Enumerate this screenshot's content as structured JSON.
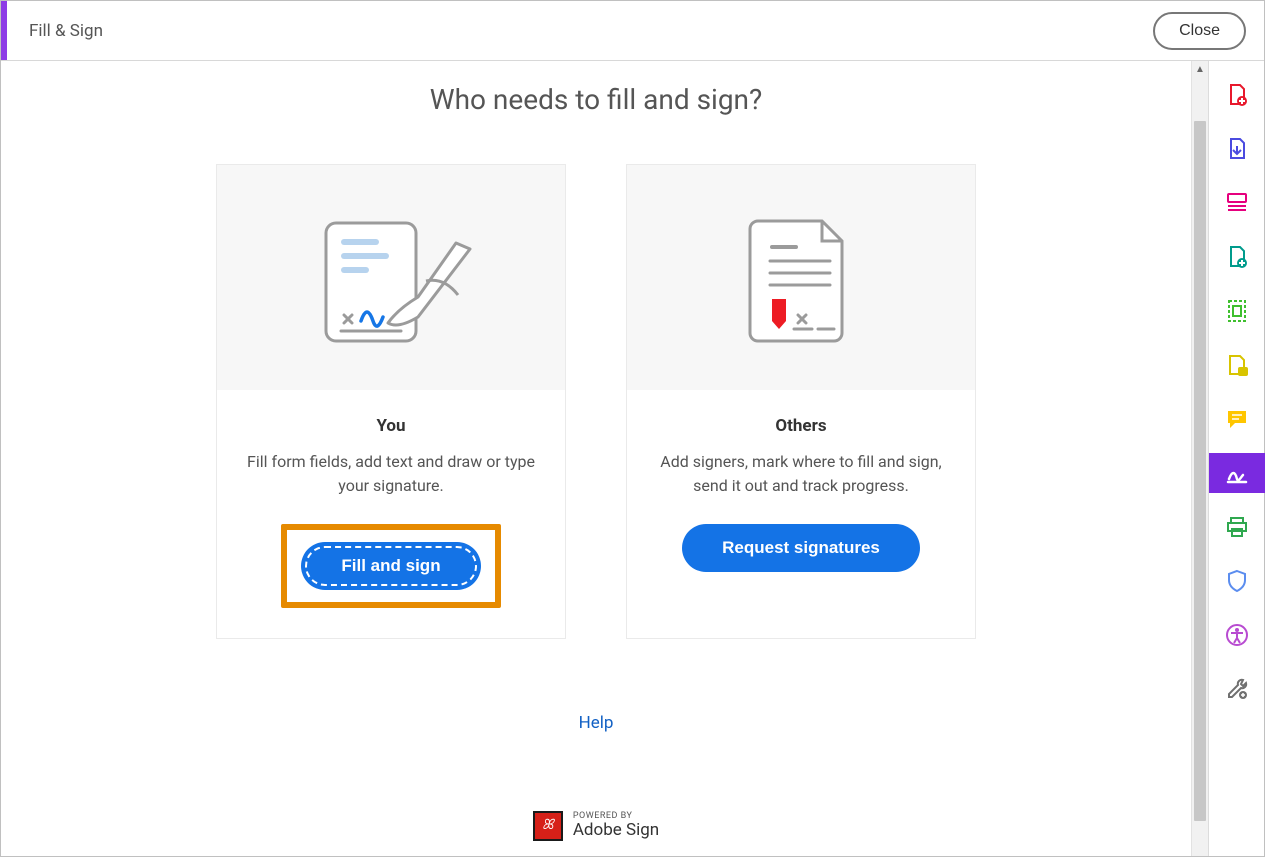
{
  "header": {
    "title": "Fill & Sign",
    "close_label": "Close"
  },
  "main": {
    "heading": "Who needs to fill and sign?",
    "cards": {
      "you": {
        "title": "You",
        "desc": "Fill form fields, add text and draw or type your signature.",
        "button": "Fill and sign"
      },
      "others": {
        "title": "Others",
        "desc": "Add signers, mark where to fill and sign, send it out and track progress.",
        "button": "Request signatures"
      }
    },
    "help_label": "Help",
    "powered_small": "POWERED BY",
    "powered_big": "Adobe Sign"
  },
  "rail": {
    "items": [
      {
        "name": "create-pdf-icon",
        "color": "#e8192c"
      },
      {
        "name": "export-pdf-icon",
        "color": "#4b4be0"
      },
      {
        "name": "organize-pages-icon",
        "color": "#e6007e"
      },
      {
        "name": "combine-files-icon",
        "color": "#009b8c"
      },
      {
        "name": "edit-pdf-icon",
        "color": "#3fbf2f"
      },
      {
        "name": "compare-icon",
        "color": "#d8c400"
      },
      {
        "name": "comment-icon",
        "color": "#ffc600"
      },
      {
        "name": "fill-sign-icon",
        "color": "#ffffff",
        "active": true
      },
      {
        "name": "print-icon",
        "color": "#2fa84f"
      },
      {
        "name": "protect-icon",
        "color": "#5b8def"
      },
      {
        "name": "accessibility-icon",
        "color": "#b84bd1"
      },
      {
        "name": "more-tools-icon",
        "color": "#707070"
      }
    ]
  }
}
